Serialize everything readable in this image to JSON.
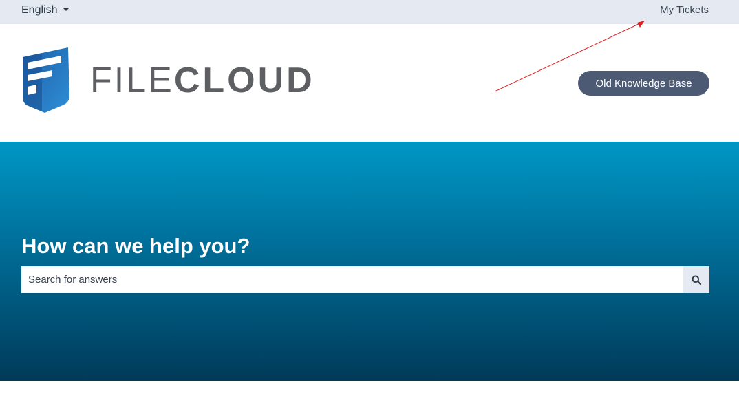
{
  "topbar": {
    "language": "English",
    "my_tickets": "My Tickets"
  },
  "header": {
    "logo_light": "FILE",
    "logo_bold": "CLOUD",
    "old_kb_button": "Old Knowledge Base"
  },
  "hero": {
    "title": "How can we help you?",
    "search_placeholder": "Search for answers"
  },
  "colors": {
    "topbar_bg": "#e4e9f2",
    "button_bg": "#4c5a74",
    "hero_top": "#0097c4",
    "hero_bottom": "#003a58",
    "annotation_arrow": "#e02020"
  }
}
